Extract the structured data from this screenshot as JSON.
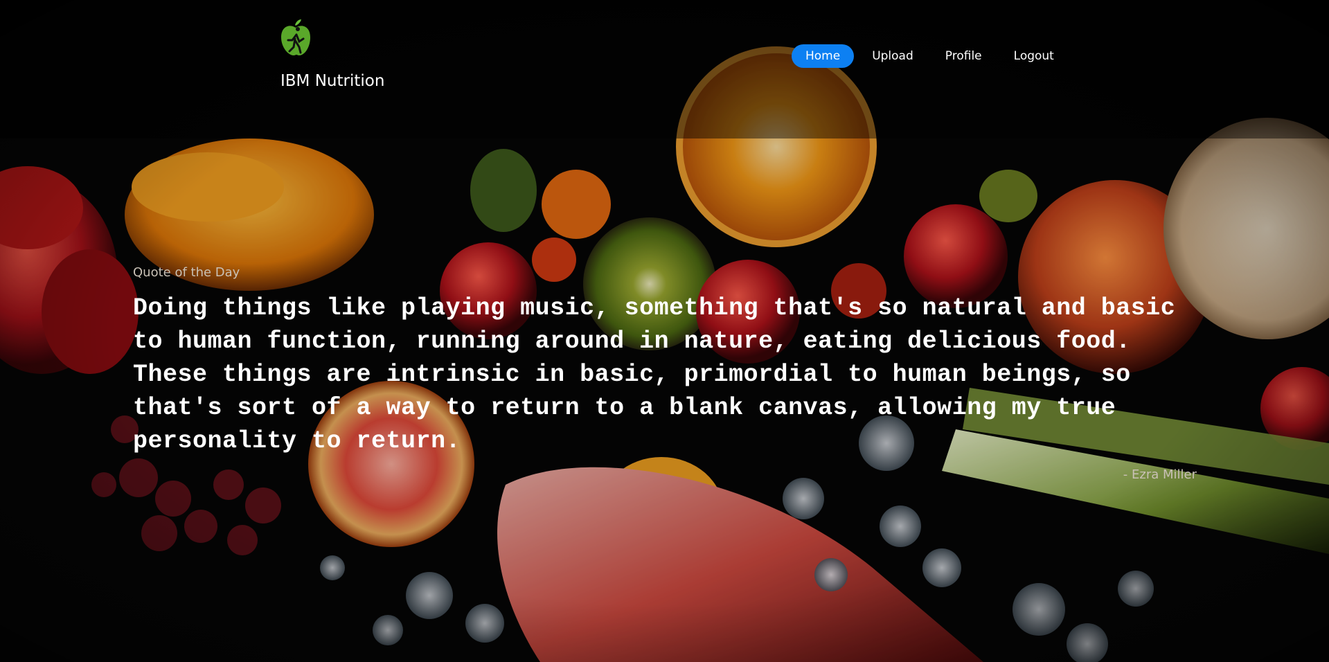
{
  "app": {
    "name": "IBM Nutrition",
    "logo_icon": "apple-runner-logo-icon"
  },
  "nav": {
    "items": [
      {
        "label": "Home",
        "active": true
      },
      {
        "label": "Upload",
        "active": false
      },
      {
        "label": "Profile",
        "active": false
      },
      {
        "label": "Logout",
        "active": false
      }
    ],
    "active_color": "#0d80f2"
  },
  "quote": {
    "label": "Quote of the Day",
    "text": "Doing things like playing music, something that's so natural and basic to human function, running around in nature, eating delicious food. These things are intrinsic in basic, primordial to human beings, so that's sort of a way to return to a blank canvas, allowing my true personality to return.",
    "author": "- Ezra Miller"
  },
  "background": {
    "description_icon": "food-background-image"
  }
}
